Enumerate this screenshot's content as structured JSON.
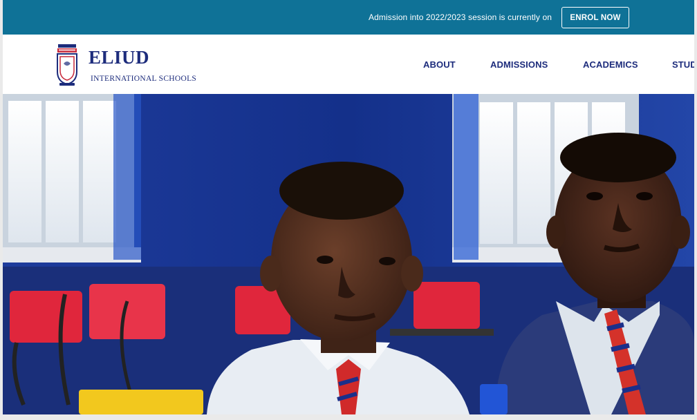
{
  "announcement": {
    "text": "Admission into 2022/2023 session is currently on",
    "button_label": "ENROL NOW"
  },
  "brand": {
    "name": "ELIUD",
    "subtitle": "INTERNATIONAL SCHOOLS"
  },
  "nav": {
    "items": [
      {
        "label": "ABOUT"
      },
      {
        "label": "ADMISSIONS"
      },
      {
        "label": "ACADEMICS"
      },
      {
        "label": "STUD"
      }
    ]
  },
  "colors": {
    "announce_bar": "#0f7297",
    "brand_navy": "#1d2c7c",
    "hero_wall": "#1c3a9a",
    "chair_red": "#e0263c"
  },
  "hero": {
    "icon": "photo-students-classroom"
  }
}
